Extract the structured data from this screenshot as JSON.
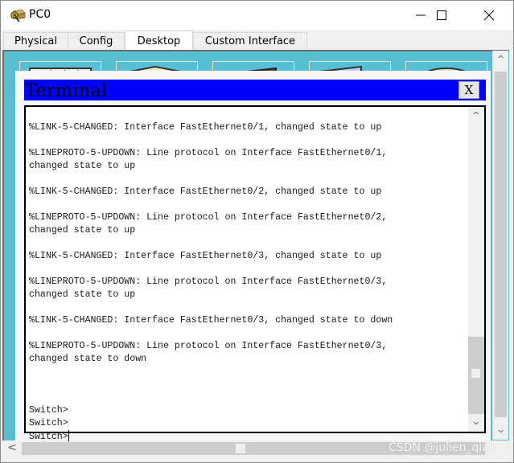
{
  "window": {
    "title": "PC0",
    "app_icon": "packet-tracer-pc-icon",
    "controls": {
      "minimize": "—",
      "maximize": "☐",
      "close": "✕"
    }
  },
  "tabs": [
    {
      "label": "Physical",
      "active": false
    },
    {
      "label": "Config",
      "active": false
    },
    {
      "label": "Desktop",
      "active": true
    },
    {
      "label": "Custom Interface",
      "active": false
    }
  ],
  "terminal": {
    "title": "Terminal",
    "close_label": "X",
    "lines": [
      "%LINK-5-CHANGED: Interface FastEthernet0/1, changed state to up",
      "",
      "%LINEPROTO-5-UPDOWN: Line protocol on Interface FastEthernet0/1,",
      "changed state to up",
      "",
      "%LINK-5-CHANGED: Interface FastEthernet0/2, changed state to up",
      "",
      "%LINEPROTO-5-UPDOWN: Line protocol on Interface FastEthernet0/2,",
      "changed state to up",
      "",
      "%LINK-5-CHANGED: Interface FastEthernet0/3, changed state to up",
      "",
      "%LINEPROTO-5-UPDOWN: Line protocol on Interface FastEthernet0/3,",
      "changed state to up",
      "",
      "%LINK-5-CHANGED: Interface FastEthernet0/3, changed state to down",
      "",
      "%LINEPROTO-5-UPDOWN: Line protocol on Interface FastEthernet0/3,",
      "changed state to down",
      "",
      "",
      "",
      "Switch>",
      "Switch>",
      "Switch>"
    ]
  },
  "scroll": {
    "up": "^",
    "down": "v",
    "left": "<"
  },
  "watermark": "CSDN @julien_qiao"
}
